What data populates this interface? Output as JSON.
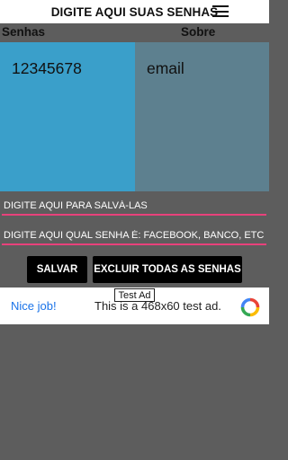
{
  "app_bar": {
    "title": "DIGITE AQUI SUAS SENHAS",
    "menu_icon": "hamburger-menu-icon"
  },
  "headers": {
    "passwords": "Senhas",
    "about": "Sobre"
  },
  "panels": {
    "password_value": "12345678",
    "about_value": "email"
  },
  "inputs": {
    "save_placeholder": "DIGITE AQUI PARA SALVÁ-LAS",
    "about_placeholder": "DIGITE AQUI QUAL SENHA É: FACEBOOK, BANCO, ETC..."
  },
  "buttons": {
    "save_label": "SALVAR",
    "delete_all_label": "EXCLUIR TODAS AS SENHAS"
  },
  "ad": {
    "tag": "Test Ad",
    "left_text": "Nice job!",
    "middle_text": "This is a 468x60 test ad.",
    "logo_icon": "ad-choices-logo-icon"
  },
  "colors": {
    "background": "#5d5d5d",
    "password_panel": "#3a9fca",
    "about_panel": "#5d808f",
    "input_underline": "#e8417b",
    "button": "#000000"
  }
}
